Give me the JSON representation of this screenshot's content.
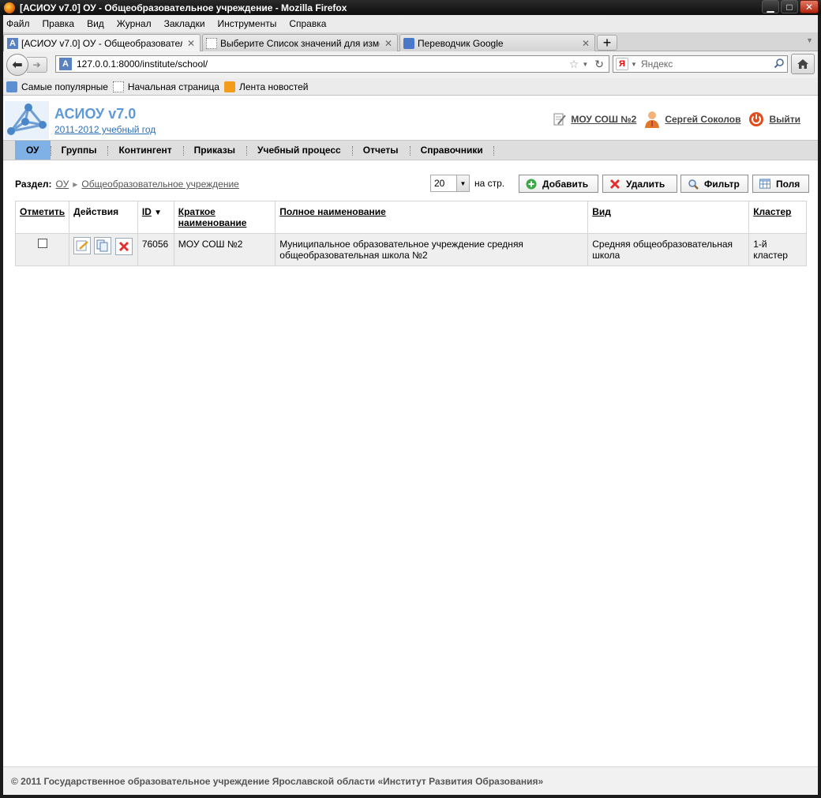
{
  "window": {
    "title": "[АСИОУ v7.0] ОУ - Общеобразовательное учреждение - Mozilla Firefox",
    "min_icon": "minimize-icon",
    "max_icon": "maximize-icon",
    "close_icon": "close-icon"
  },
  "menu": [
    "Файл",
    "Правка",
    "Вид",
    "Журнал",
    "Закладки",
    "Инструменты",
    "Справка"
  ],
  "tabs": [
    {
      "label": "[АСИОУ v7.0] ОУ - Общеобразователь...",
      "close": "✕"
    },
    {
      "label": "Выберите Список значений для измен...",
      "close": "✕"
    },
    {
      "label": "Переводчик Google",
      "close": "✕"
    }
  ],
  "new_tab": "+",
  "nav": {
    "url": "127.0.0.1:8000/institute/school/",
    "search_placeholder": "Яндекс",
    "search_engine_letter": "Я"
  },
  "bookmarks": [
    "Самые популярные",
    "Начальная страница",
    "Лента новостей"
  ],
  "app": {
    "title": "АСИОУ v7.0",
    "year": "2011-2012 учебный год",
    "school_link": "МОУ СОШ №2",
    "user_link": "Сергей Соколов",
    "logout_link": "Выйти"
  },
  "navtabs": [
    "ОУ",
    "Группы",
    "Контингент",
    "Приказы",
    "Учебный процесс",
    "Отчеты",
    "Справочники"
  ],
  "toolbar": {
    "section_label": "Раздел:",
    "crumb_root": "ОУ",
    "crumb_current": "Общеобразовательное учреждение",
    "page_size": "20",
    "per_page": "на стр.",
    "add": "Добавить",
    "delete": "Удалить",
    "filter": "Фильтр",
    "fields": "Поля"
  },
  "table": {
    "headers": {
      "mark": "Отметить",
      "actions": "Действия",
      "id": "ID",
      "short_name": "Краткое наименование",
      "full_name": "Полное наименование",
      "kind": "Вид",
      "cluster": "Кластер"
    },
    "rows": [
      {
        "id": "76056",
        "short_name": "МОУ СОШ №2",
        "full_name": "Муниципальное образовательное учреждение средняя общеобразовательная школа №2",
        "kind": "Средняя общеобразовательная школа",
        "cluster": "1-й кластер"
      }
    ]
  },
  "footer": "© 2011 Государственное образовательное учреждение Ярославской области «Институт Развития Образования»",
  "colors": {
    "accent": "#5f9ad6",
    "active_tab": "#7fb0e6",
    "delete_red": "#e03030",
    "add_green": "#3aa845"
  }
}
